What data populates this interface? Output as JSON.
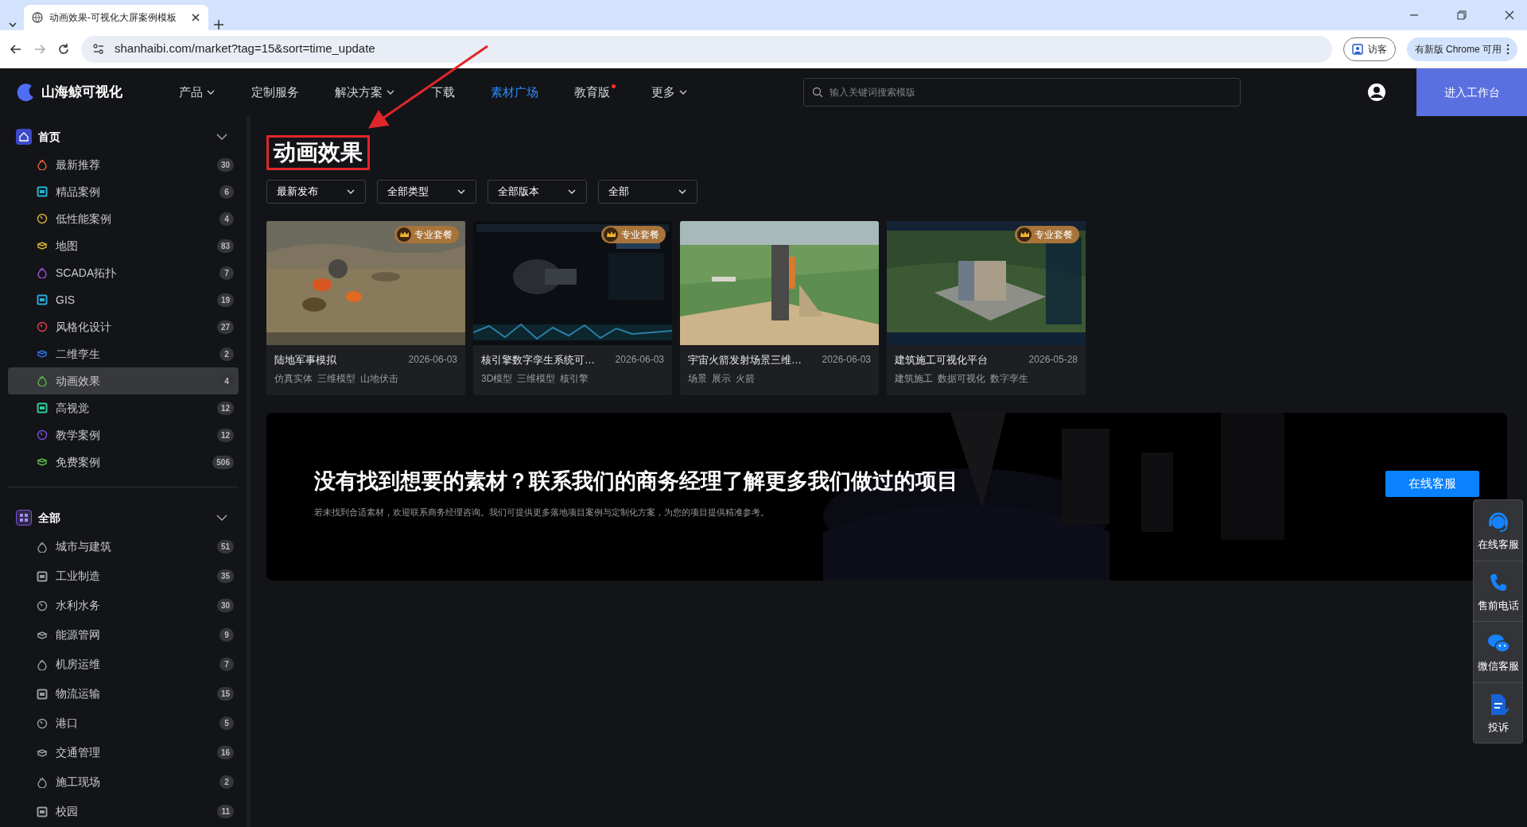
{
  "browser": {
    "tab_title": "动画效果-可视化大屏案例模板",
    "url": "shanhaibi.com/market?tag=15&sort=time_update",
    "profile_button": "访客",
    "update_button": "有新版 Chrome 可用"
  },
  "nav": {
    "logo": "山海鲸可视化",
    "items": [
      {
        "label": "产品",
        "dropdown": true,
        "selected": false,
        "dot": false
      },
      {
        "label": "定制服务",
        "dropdown": false,
        "selected": false,
        "dot": false
      },
      {
        "label": "解决方案",
        "dropdown": true,
        "selected": false,
        "dot": false
      },
      {
        "label": "下载",
        "dropdown": false,
        "selected": false,
        "dot": false
      },
      {
        "label": "素材广场",
        "dropdown": false,
        "selected": true,
        "dot": false
      },
      {
        "label": "教育版",
        "dropdown": false,
        "selected": false,
        "dot": true
      },
      {
        "label": "更多",
        "dropdown": true,
        "selected": false,
        "dot": false
      }
    ],
    "search": {
      "placeholder": "输入关键词搜索模版"
    },
    "workspace_button": "进入工作台"
  },
  "sidebar": [
    {
      "title": "首页",
      "expanded": true,
      "color": "#3b49c9",
      "items": [
        {
          "label": "最新推荐",
          "count": "30",
          "selected": false,
          "color": "#f0603a"
        },
        {
          "label": "精品案例",
          "count": "6",
          "selected": false,
          "color": "#22b5d6"
        },
        {
          "label": "低性能案例",
          "count": "4",
          "selected": false,
          "color": "#d6b43a"
        },
        {
          "label": "地图",
          "count": "83",
          "selected": false,
          "color": "#d6b43a"
        },
        {
          "label": "SCADA拓扑",
          "count": "7",
          "selected": false,
          "color": "#a257e0"
        },
        {
          "label": "GIS",
          "count": "19",
          "selected": false,
          "color": "#2aa8d8"
        },
        {
          "label": "风格化设计",
          "count": "27",
          "selected": false,
          "color": "#e8404a"
        },
        {
          "label": "二维孪生",
          "count": "2",
          "selected": false,
          "color": "#2f6fe0"
        },
        {
          "label": "动画效果",
          "count": "4",
          "selected": true,
          "color": "#5cb84a"
        },
        {
          "label": "高视觉",
          "count": "12",
          "selected": false,
          "color": "#2fc9a0"
        },
        {
          "label": "教学案例",
          "count": "12",
          "selected": false,
          "color": "#7a4ee0"
        },
        {
          "label": "免费案例",
          "count": "506",
          "selected": false,
          "color": "#5cb84a"
        }
      ]
    },
    {
      "title": "全部",
      "expanded": true,
      "color": "#7a4ee0",
      "items": [
        {
          "label": "城市与建筑",
          "count": "51",
          "selected": false,
          "color": "#9a9ca3"
        },
        {
          "label": "工业制造",
          "count": "35",
          "selected": false,
          "color": "#9a9ca3"
        },
        {
          "label": "水利水务",
          "count": "30",
          "selected": false,
          "color": "#9a9ca3"
        },
        {
          "label": "能源管网",
          "count": "9",
          "selected": false,
          "color": "#9a9ca3"
        },
        {
          "label": "机房运维",
          "count": "7",
          "selected": false,
          "color": "#9a9ca3"
        },
        {
          "label": "物流运输",
          "count": "15",
          "selected": false,
          "color": "#9a9ca3"
        },
        {
          "label": "港口",
          "count": "5",
          "selected": false,
          "color": "#9a9ca3"
        },
        {
          "label": "交通管理",
          "count": "16",
          "selected": false,
          "color": "#9a9ca3"
        },
        {
          "label": "施工现场",
          "count": "2",
          "selected": false,
          "color": "#9a9ca3"
        },
        {
          "label": "校园",
          "count": "11",
          "selected": false,
          "color": "#9a9ca3"
        }
      ]
    }
  ],
  "page_title": "动画效果",
  "filters": [
    "最新发布",
    "全部类型",
    "全部版本",
    "全部"
  ],
  "cards": [
    {
      "title": "陆地军事模拟",
      "date": "2026-06-03",
      "badge": "专业套餐",
      "tags": [
        "仿真实体",
        "三维模型",
        "山地伏击"
      ]
    },
    {
      "title": "核引擎数字孪生系统可…",
      "date": "2026-06-03",
      "badge": "专业套餐",
      "tags": [
        "3D模型",
        "三维模型",
        "核引擎"
      ]
    },
    {
      "title": "宇宙火箭发射场景三维…",
      "date": "2026-06-03",
      "tags": [
        "场景",
        "展示",
        "火箭"
      ]
    },
    {
      "title": "建筑施工可视化平台",
      "date": "2026-05-28",
      "badge": "专业套餐",
      "tags": [
        "建筑施工",
        "数据可视化",
        "数字孪生"
      ]
    }
  ],
  "banner": {
    "heading": "没有找到想要的素材？联系我们的商务经理了解更多我们做过的项目",
    "text": "若未找到合适素材，欢迎联系商务经理咨询。我们可提供更多落地项目案例与定制化方案，为您的项目提供精准参考。",
    "button": "在线客服"
  },
  "float_bar": [
    {
      "kind": "headset",
      "label": "在线客服"
    },
    {
      "kind": "phone",
      "label": "售前电话"
    },
    {
      "kind": "chat",
      "label": "微信客服"
    },
    {
      "kind": "document",
      "label": "投诉"
    }
  ]
}
